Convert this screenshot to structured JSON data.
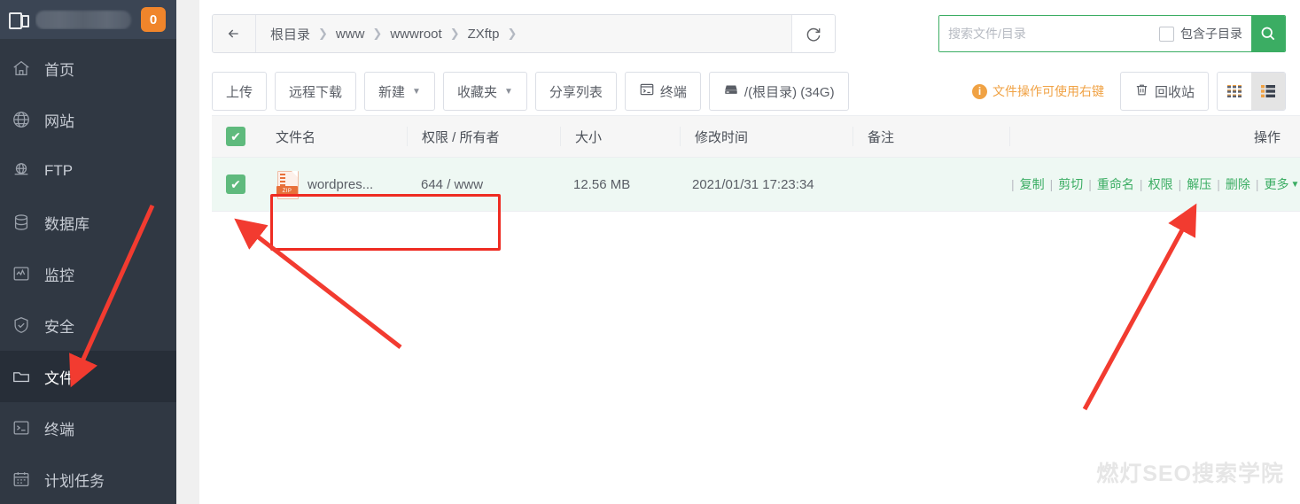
{
  "sidebar": {
    "logo_text": "",
    "badge": "0",
    "items": [
      {
        "label": "首页",
        "icon": "home-icon",
        "active": false
      },
      {
        "label": "网站",
        "icon": "globe-icon",
        "active": false
      },
      {
        "label": "FTP",
        "icon": "ftp-icon",
        "active": false
      },
      {
        "label": "数据库",
        "icon": "database-icon",
        "active": false
      },
      {
        "label": "监控",
        "icon": "monitor-icon",
        "active": false
      },
      {
        "label": "安全",
        "icon": "shield-icon",
        "active": false
      },
      {
        "label": "文件",
        "icon": "folder-icon",
        "active": true
      },
      {
        "label": "终端",
        "icon": "terminal-icon",
        "active": false
      },
      {
        "label": "计划任务",
        "icon": "calendar-icon",
        "active": false
      }
    ]
  },
  "topbar": {
    "back_icon": "arrow-left-icon",
    "refresh_icon": "refresh-icon",
    "breadcrumb": [
      "根目录",
      "www",
      "wwwroot",
      "ZXftp"
    ],
    "breadcrumb_separator": "❯",
    "search": {
      "placeholder": "搜索文件/目录",
      "value": "",
      "subdir_label": "包含子目录",
      "subdir_checked": false,
      "go_icon": "search-icon"
    }
  },
  "toolbar": {
    "buttons": [
      {
        "label": "上传",
        "caret": false,
        "icon": ""
      },
      {
        "label": "远程下载",
        "caret": false,
        "icon": ""
      },
      {
        "label": "新建",
        "caret": true,
        "icon": ""
      },
      {
        "label": "收藏夹",
        "caret": true,
        "icon": ""
      },
      {
        "label": "分享列表",
        "caret": false,
        "icon": ""
      },
      {
        "label": "终端",
        "caret": false,
        "icon": "terminal-icon"
      },
      {
        "label": "/(根目录) (34G)",
        "caret": false,
        "icon": "disk-icon"
      }
    ],
    "tip": "文件操作可使用右键",
    "tip_icon": "info-icon",
    "recycle_label": "回收站",
    "recycle_icon": "trash-icon",
    "view_grid_icon": "grid-view-icon",
    "view_list_icon": "list-view-icon",
    "view_active": "list"
  },
  "table": {
    "headers": {
      "name": "文件名",
      "perm": "权限 / 所有者",
      "size": "大小",
      "time": "修改时间",
      "note": "备注",
      "op": "操作"
    },
    "rows": [
      {
        "checked": true,
        "icon": "zip-file-icon",
        "icon_label": "ZIP",
        "name": "wordpres...",
        "perm": "644 / www",
        "size": "12.56 MB",
        "time": "2021/01/31 17:23:34",
        "note": "",
        "ops": [
          "复制",
          "剪切",
          "重命名",
          "权限",
          "解压",
          "删除"
        ],
        "ops_more": "更多"
      }
    ]
  },
  "annotations": {
    "highlight_color": "#ee2c22",
    "arrow_color": "#f23b30",
    "targets": [
      "sidebar-item-files",
      "file-name-cell",
      "unzip-link"
    ]
  },
  "watermark": "燃灯SEO搜索学院",
  "colors": {
    "sidebar_bg": "#303843",
    "sidebar_active": "#272e38",
    "accent_green": "#3bad63",
    "badge_orange": "#f0852b",
    "row_selected": "#eef8f3"
  }
}
